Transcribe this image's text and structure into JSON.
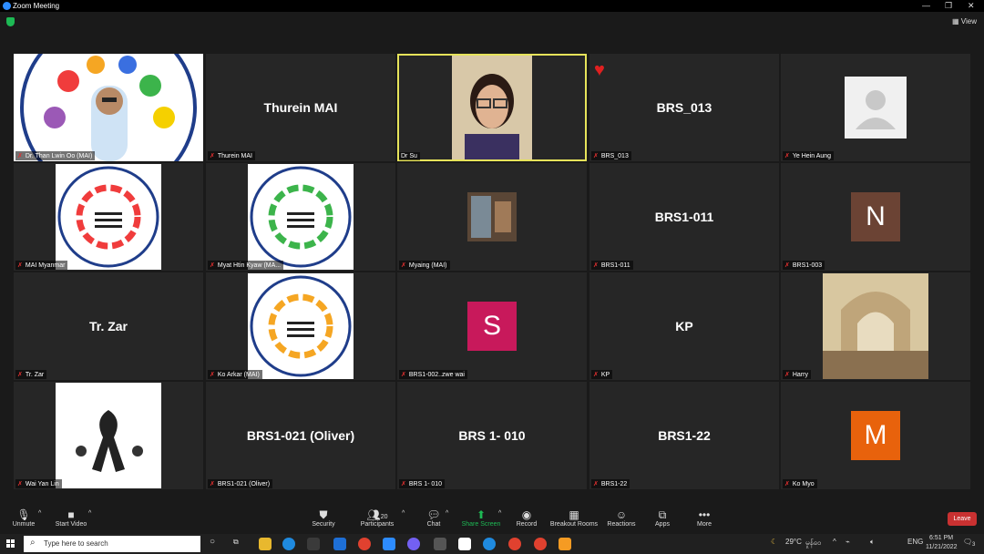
{
  "window": {
    "title": "Zoom Meeting"
  },
  "topbar": {
    "view_label": "View"
  },
  "tiles": [
    {
      "name": "Dr. Than Lwin Oo (MAI)"
    },
    {
      "name": "Thurein MAI",
      "display": "Thurein MAI"
    },
    {
      "name": "Dr Su"
    },
    {
      "name": "BRS_013",
      "display": "BRS_013"
    },
    {
      "name": "Ye Hein Aung"
    },
    {
      "name": "MAI Myanmar"
    },
    {
      "name": "Myat Htin Kyaw (MA..."
    },
    {
      "name": "Myaing (MAI)"
    },
    {
      "name": "BRS1-011",
      "display": "BRS1-011"
    },
    {
      "name": "BRS1-003",
      "initial": "N",
      "color": "#6b4334"
    },
    {
      "name": "Tr. Zar",
      "display": "Tr. Zar"
    },
    {
      "name": "Ko Arkar (MAI)"
    },
    {
      "name": "BRS1-002..zwe wai",
      "initial": "S",
      "color": "#c8195b"
    },
    {
      "name": "KP",
      "display": "KP"
    },
    {
      "name": "Harry"
    },
    {
      "name": "Wai Yan Lin"
    },
    {
      "name": "BRS1-021 (Oliver)",
      "display": "BRS1-021 (Oliver)"
    },
    {
      "name": "BRS 1- 010",
      "display": "BRS 1- 010"
    },
    {
      "name": "BRS1-22",
      "display": "BRS1-22"
    },
    {
      "name": "Ko Myo",
      "initial": "M",
      "color": "#e8620c"
    }
  ],
  "logo_text": {
    "top": "Minority Affairs Institute",
    "bottom": "M A I"
  },
  "toolbar": {
    "unmute": "Unmute",
    "start_video": "Start Video",
    "security": "Security",
    "participants": "Participants",
    "participants_count": "20",
    "chat": "Chat",
    "share_screen": "Share Screen",
    "record": "Record",
    "breakout": "Breakout Rooms",
    "reactions": "Reactions",
    "apps": "Apps",
    "more": "More",
    "leave": "Leave"
  },
  "taskbar": {
    "search_placeholder": "Type here to search",
    "weather": "29°C",
    "weather_text": "မှုန်ဝေ",
    "lang": "ENG",
    "time": "6:51 PM",
    "date": "11/21/2022",
    "notif_count": "3"
  }
}
